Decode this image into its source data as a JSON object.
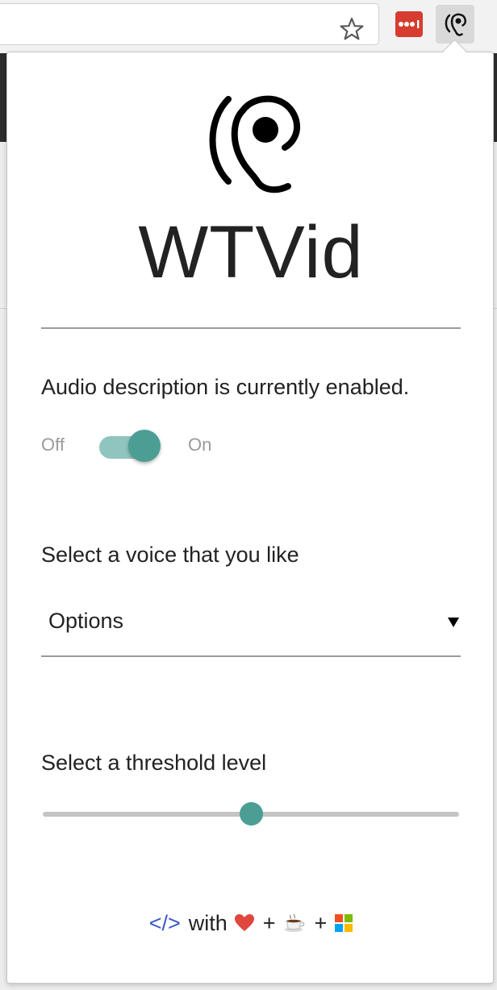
{
  "app": {
    "title": "WTVid"
  },
  "audio": {
    "status_text": "Audio description is currently enabled.",
    "toggle_off_label": "Off",
    "toggle_on_label": "On",
    "enabled": true
  },
  "voice": {
    "label": "Select a voice that you like",
    "selected": "Options"
  },
  "threshold": {
    "label": "Select a threshold level",
    "value": 0.5
  },
  "footer": {
    "code_symbol": "</>",
    "with_text": "with",
    "plus1": "+",
    "plus2": "+"
  },
  "colors": {
    "accent": "#4b9e94",
    "accent_light": "#8fc4bf",
    "lastpass": "#d63c2f",
    "code_blue": "#3b57c9"
  },
  "icons": {
    "logo": "ear-icon",
    "bookmark": "star-icon",
    "lastpass": "lastpass-icon",
    "extension": "ear-icon",
    "dropdown": "chevron-down-icon",
    "footer": [
      "code-icon",
      "heart-icon",
      "coffee-icon",
      "windows-icon"
    ]
  }
}
